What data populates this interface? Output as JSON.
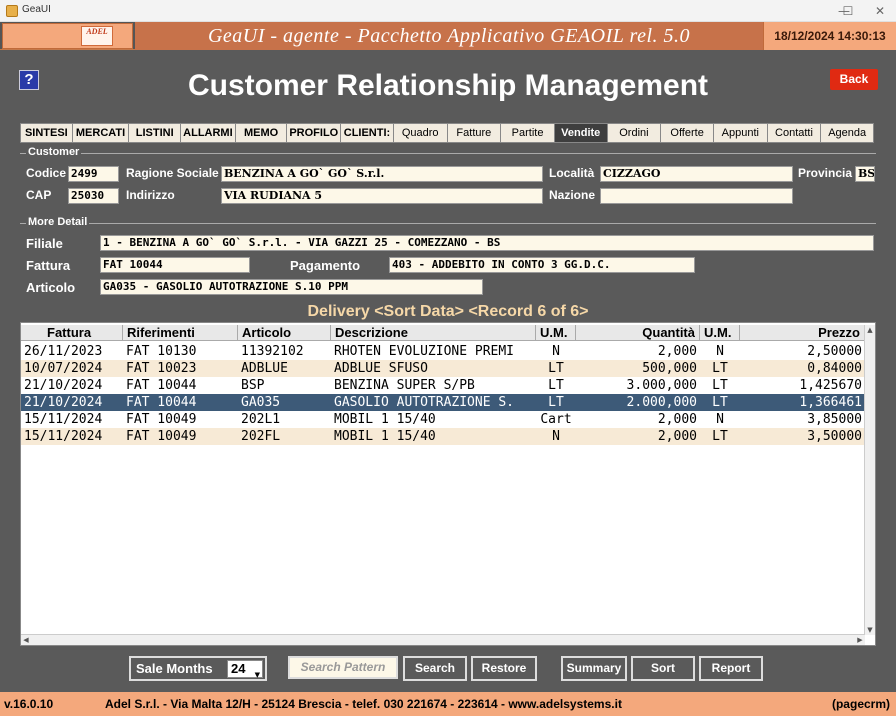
{
  "window": {
    "title": "GeaUI",
    "minimize": "—",
    "maximize": "☐",
    "close": "✕"
  },
  "header": {
    "logo_text": "ADEL",
    "title": "GeaUI - agente - Pacchetto Applicativo GEAOIL rel. 5.0",
    "datetime": "18/12/2024 14:30:13"
  },
  "page": {
    "help_label": "?",
    "title": "Customer Relationship Management",
    "back_label": "Back"
  },
  "tabs": [
    {
      "label": "SINTESI"
    },
    {
      "label": "MERCATI"
    },
    {
      "label": "LISTINI"
    },
    {
      "label": "ALLARMI"
    },
    {
      "label": "MEMO"
    },
    {
      "label": "PROFILO"
    },
    {
      "label": "CLIENTI:"
    },
    {
      "label": "Quadro"
    },
    {
      "label": "Fatture"
    },
    {
      "label": "Partite"
    },
    {
      "label": "Vendite"
    },
    {
      "label": "Ordini"
    },
    {
      "label": "Offerte"
    },
    {
      "label": "Appunti"
    },
    {
      "label": "Contatti"
    },
    {
      "label": "Agenda"
    }
  ],
  "customer": {
    "legend": "Customer",
    "codice_label": "Codice",
    "codice": "2499",
    "ragione_label": "Ragione Sociale",
    "ragione": "BENZINA A GO` GO` S.r.l.",
    "localita_label": "Località",
    "localita": "CIZZAGO",
    "provincia_label": "Provincia",
    "provincia": "BS",
    "cap_label": "CAP",
    "cap": "25030",
    "indirizzo_label": "Indirizzo",
    "indirizzo": "VIA RUDIANA 5",
    "nazione_label": "Nazione",
    "nazione": ""
  },
  "detail": {
    "legend": "More Detail",
    "filiale_label": "Filiale",
    "filiale": "1 - BENZINA A GO` GO` S.r.l. - VIA GAZZI 25 - COMEZZANO - BS",
    "fattura_label": "Fattura",
    "fattura": "FAT 10044",
    "pagamento_label": "Pagamento",
    "pagamento": "403 - ADDEBITO IN CONTO 3 GG.D.C.",
    "articolo_label": "Articolo",
    "articolo": "GA035  - GASOLIO AUTOTRAZIONE S.10 PPM"
  },
  "grid": {
    "title": "Delivery <Sort Data> <Record 6 of  6>",
    "columns": [
      "Fattura",
      "Riferimenti",
      "Articolo",
      "Descrizione",
      "U.M.",
      "Quantità",
      "U.M.",
      "Prezzo"
    ],
    "rows": [
      {
        "fattura": "26/11/2023",
        "rif": "FAT 10130",
        "art": "11392102",
        "desc": "RHOTEN EVOLUZIONE PREMI",
        "um1": "N",
        "qta": "2,000",
        "um2": "N",
        "prezzo": "2,50000"
      },
      {
        "fattura": "10/07/2024",
        "rif": "FAT 10023",
        "art": "ADBLUE",
        "desc": "ADBLUE SFUSO",
        "um1": "LT",
        "qta": "500,000",
        "um2": "LT",
        "prezzo": "0,84000"
      },
      {
        "fattura": "21/10/2024",
        "rif": "FAT 10044",
        "art": "BSP",
        "desc": "BENZINA SUPER S/PB",
        "um1": "LT",
        "qta": "3.000,000",
        "um2": "LT",
        "prezzo": "1,425670"
      },
      {
        "fattura": "21/10/2024",
        "rif": "FAT 10044",
        "art": "GA035",
        "desc": "GASOLIO AUTOTRAZIONE S.",
        "um1": "LT",
        "qta": "2.000,000",
        "um2": "LT",
        "prezzo": "1,366461"
      },
      {
        "fattura": "15/11/2024",
        "rif": "FAT 10049",
        "art": "202L1",
        "desc": "MOBIL 1 15/40",
        "um1": "Cart",
        "qta": "2,000",
        "um2": "N",
        "prezzo": "3,85000"
      },
      {
        "fattura": "15/11/2024",
        "rif": "FAT 10049",
        "art": "202FL",
        "desc": "MOBIL 1 15/40",
        "um1": "N",
        "qta": "2,000",
        "um2": "LT",
        "prezzo": "3,50000"
      }
    ],
    "selected_row": 3
  },
  "toolbar": {
    "sale_months_label": "Sale Months",
    "sale_months_value": "24",
    "search_pattern_placeholder": "Search Pattern",
    "search_label": "Search",
    "restore_label": "Restore",
    "summary_label": "Summary",
    "sort_label": "Sort",
    "report_label": "Report"
  },
  "footer": {
    "version": "v.16.0.10",
    "company": "Adel S.r.l. - Via Malta 12/H - 25124 Brescia - telef. 030 221674 - 223614 - www.adelsystems.it",
    "page_id": "(pagecrm)"
  },
  "colors": {
    "app_bg": "#5a5a5a",
    "header_accent": "#c7724a",
    "footer_bg": "#f4a87c",
    "selected_row": "#3d5a78",
    "alt_row": "#f7ead6",
    "back_button": "#e02a12"
  }
}
